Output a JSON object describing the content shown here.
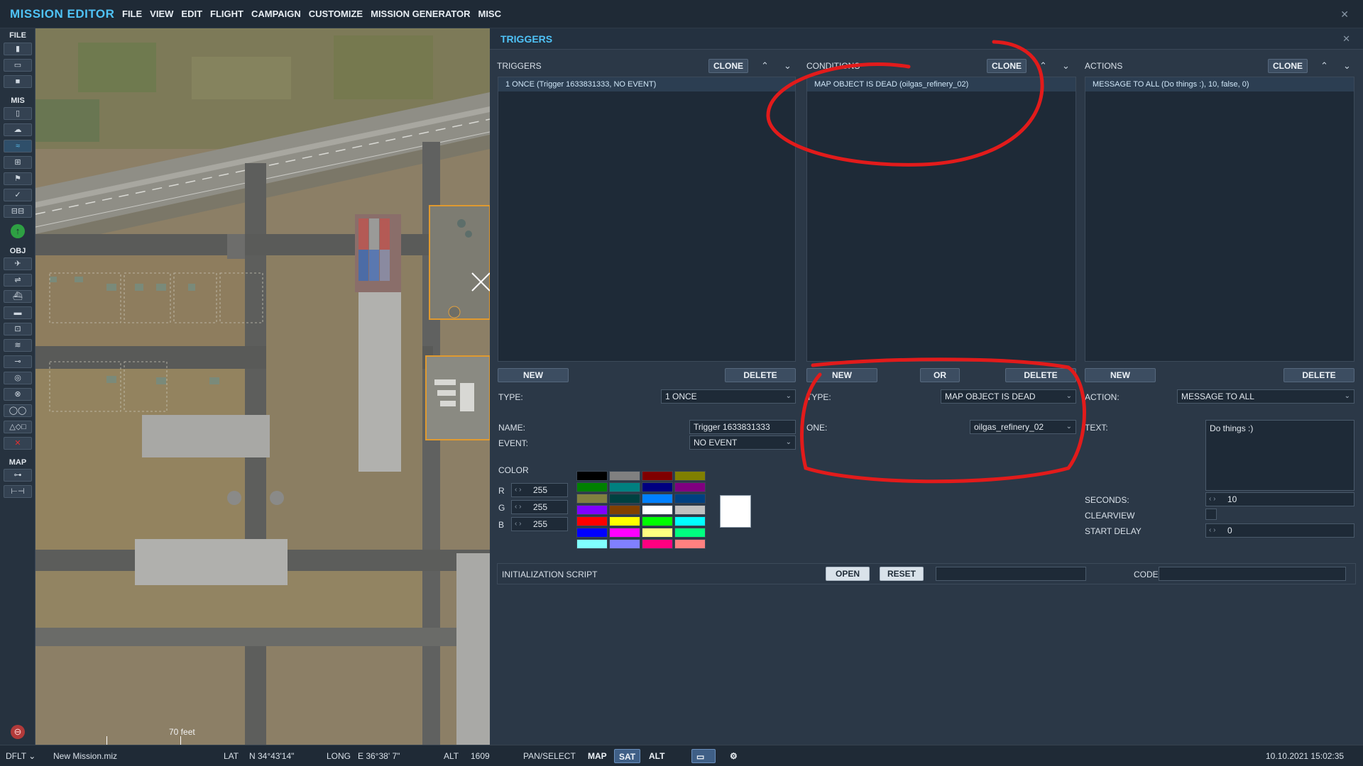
{
  "app_title": "MISSION EDITOR",
  "menu": [
    "FILE",
    "VIEW",
    "EDIT",
    "FLIGHT",
    "CAMPAIGN",
    "CUSTOMIZE",
    "MISSION GENERATOR",
    "MISC"
  ],
  "toolbar": {
    "sections": {
      "file": "FILE",
      "mis": "MIS",
      "obj": "OBJ",
      "map": "MAP"
    },
    "buttons": {
      "new": "▮",
      "open": "▭",
      "save": "■",
      "clipboard": "▯",
      "weather": "☁",
      "route": "≈",
      "target": "⊞",
      "flag": "⚑",
      "check": "✓",
      "chain": "⊟⊟",
      "up": "↑",
      "plane": "✈",
      "heli": "⇌",
      "ship": "⛴",
      "vehicle": "▬",
      "static": "⊡",
      "road": "≋",
      "point": "⊸",
      "circle": "◎",
      "zone": "⊗",
      "rings": "◯◯",
      "shapes": "△◇□",
      "delete": "✕",
      "ruler": "⊶",
      "measure": "⊢⊣",
      "bottom": "⊖"
    },
    "colors": {
      "active": "#5bc0f0",
      "green": "#2ea043",
      "red": "#e03030"
    }
  },
  "map": {
    "scale_label": "70 feet"
  },
  "panel": {
    "title": "TRIGGERS",
    "close": "✕",
    "triggers": {
      "title": "TRIGGERS",
      "clone": "CLONE",
      "up": "⌃",
      "down": "⌄",
      "items": [
        "1 ONCE (Trigger 1633831333, NO EVENT)"
      ],
      "new": "NEW",
      "delete": "DELETE",
      "type_label": "TYPE:",
      "type_value": "1 ONCE",
      "name_label": "NAME:",
      "name_value": "Trigger 1633831333",
      "event_label": "EVENT:",
      "event_value": "NO EVENT"
    },
    "conditions": {
      "title": "CONDITIONS",
      "clone": "CLONE",
      "up": "⌃",
      "down": "⌄",
      "items": [
        "MAP OBJECT IS DEAD (oilgas_refinery_02)"
      ],
      "new": "NEW",
      "or": "OR",
      "delete": "DELETE",
      "type_label": "TYPE:",
      "type_value": "MAP OBJECT IS DEAD",
      "zone_label": "ONE:",
      "zone_value": "oilgas_refinery_02"
    },
    "actions": {
      "title": "ACTIONS",
      "clone": "CLONE",
      "up": "⌃",
      "down": "⌄",
      "items": [
        "MESSAGE TO ALL (Do things :), 10, false, 0)"
      ],
      "new": "NEW",
      "delete": "DELETE",
      "action_label": "ACTION:",
      "action_value": "MESSAGE TO ALL",
      "text_label": "TEXT:",
      "text_value": "Do things :)",
      "seconds_label": "SECONDS:",
      "seconds_value": "10",
      "clearview_label": "CLEARVIEW",
      "start_delay_label": "START DELAY",
      "start_delay_value": "0"
    },
    "color": {
      "label": "COLOR",
      "r_label": "R",
      "r_value": "255",
      "g_label": "G",
      "g_value": "255",
      "b_label": "B",
      "b_value": "255",
      "palette": [
        "#000000",
        "#808080",
        "#800000",
        "#808000",
        "#008000",
        "#008080",
        "#000080",
        "#800080",
        "#808040",
        "#004040",
        "#0080ff",
        "#004080",
        "#8000ff",
        "#804000",
        "#ffffff",
        "#c0c0c0",
        "#ff0000",
        "#ffff00",
        "#00ff00",
        "#00ffff",
        "#0000ff",
        "#ff00ff",
        "#ffff80",
        "#00ff80",
        "#80ffff",
        "#8080ff",
        "#ff0080",
        "#ff8080"
      ],
      "preview": "#ffffff"
    },
    "init": {
      "label": "INITIALIZATION SCRIPT",
      "open": "OPEN",
      "reset": "RESET",
      "code_label": "CODE"
    }
  },
  "statusbar": {
    "profile": "DFLT",
    "profile_chevron": "⌄",
    "file": "New Mission.miz",
    "lat_label": "LAT",
    "lat_value": "N 34°43'14\"",
    "long_label": "LONG",
    "long_value": "E 36°38' 7\"",
    "alt_label": "ALT",
    "alt_value": "1609",
    "mode": "PAN/SELECT",
    "map_btn": "MAP",
    "sat_btn": "SAT",
    "alt_btn": "ALT",
    "datetime": "10.10.2021 15:02:35"
  },
  "window_close": "✕"
}
